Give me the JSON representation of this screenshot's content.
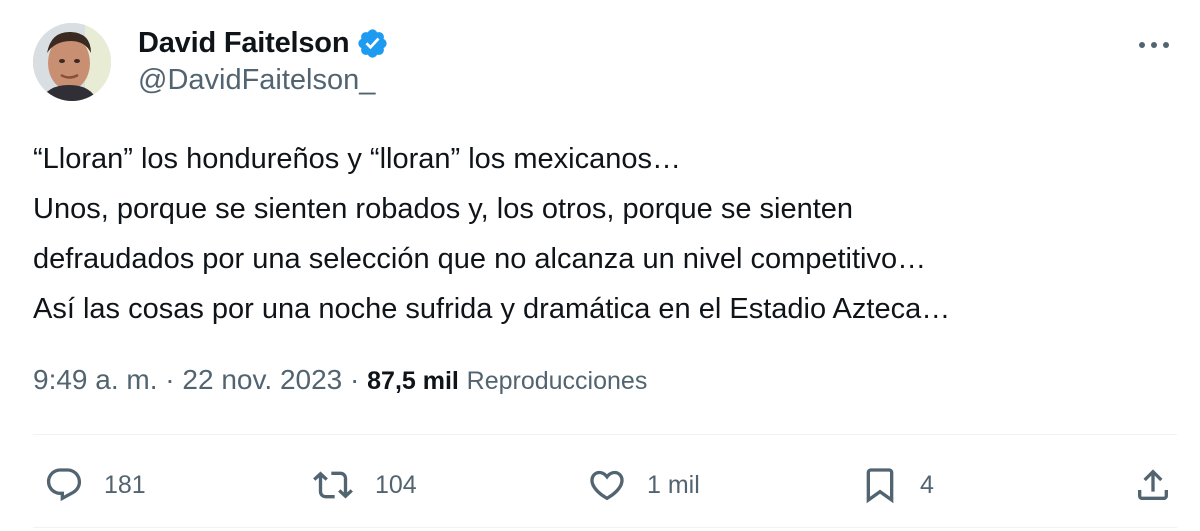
{
  "author": {
    "name": "David Faitelson",
    "handle": "@DavidFaitelson_",
    "verified_color": "#1d9bf0"
  },
  "tweet": {
    "lines": [
      "“Lloran” los hondureños y “lloran” los mexicanos…",
      "Unos, porque se sienten robados y, los otros, porque se sienten",
      "defraudados por una selección que no alcanza un nivel competitivo…",
      "Así las cosas por una noche sufrida y dramática en el Estadio Azteca…"
    ],
    "time": "9:49 a. m.",
    "separator": "·",
    "date": "22 nov. 2023",
    "views_count": "87,5 mil",
    "views_label": "Reproducciones"
  },
  "actions": {
    "replies": {
      "icon": "reply-icon",
      "count": "181"
    },
    "retweets": {
      "icon": "retweet-icon",
      "count": "104"
    },
    "likes": {
      "icon": "heart-icon",
      "count": "1 mil"
    },
    "bookmarks": {
      "icon": "bookmark-icon",
      "count": "4"
    },
    "share": {
      "icon": "share-icon"
    }
  },
  "more_icon": "more-horizontal-icon"
}
